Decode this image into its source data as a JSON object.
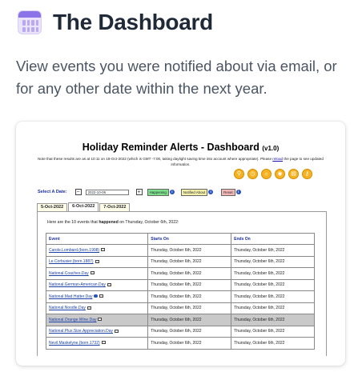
{
  "hero": {
    "icon": "calendar-icon",
    "title": "The Dashboard",
    "description": "View events you were notified about via email, or for any other date within the next year."
  },
  "app": {
    "title": "Holiday Reminder Alerts - Dashboard",
    "version": "(v1.0)",
    "note_before_link": "Note that these results are as at 10:11 on 18-Oct-2022 (which is GMT -7:00, taking daylight saving time into account where appropriate). Please",
    "note_link": "reload",
    "note_after_link": "the page to see updated information.",
    "toolbar_icons": [
      "search-icon",
      "clock-icon",
      "bulb-icon",
      "chat-icon",
      "document-icon",
      "key-icon"
    ],
    "accent_color": "#f6b220"
  },
  "date_selector": {
    "label": "Select A Date:",
    "decrement": "−",
    "value": "2022-10-06",
    "increment": "+",
    "happening_label": "Happening",
    "notified_label": "Notified About",
    "reset_label": "Reset",
    "info_glyph": "i"
  },
  "tabs": [
    "5-Oct-2022",
    "6-Oct-2022",
    "7-Oct-2022"
  ],
  "active_tab": 1,
  "results": {
    "intro_before": "Here are the 10 events that",
    "intro_bold": "happened",
    "intro_after": "on Thursday, October 6th, 2022:",
    "columns": [
      "Event",
      "Starts On",
      "Ends On"
    ],
    "rows": [
      {
        "event": "Carole.Lombard.(born.1908)",
        "starts": "Thursday, October 6th, 2022",
        "ends": "Thursday, October 6th, 2022"
      },
      {
        "event": "Le.Corbusier.(born.1887)",
        "starts": "Thursday, October 6th, 2022",
        "ends": "Thursday, October 6th, 2022"
      },
      {
        "event": "National.Coaches.Day",
        "starts": "Thursday, October 6th, 2022",
        "ends": "Thursday, October 6th, 2022"
      },
      {
        "event": "National.German-American.Day",
        "starts": "Thursday, October 6th, 2022",
        "ends": "Thursday, October 6th, 2022"
      },
      {
        "event": "National.Mad.Hatter.Day",
        "starts": "Thursday, October 6th, 2022",
        "ends": "Thursday, October 6th, 2022"
      },
      {
        "event": "National.Noodle.Day",
        "starts": "Thursday, October 6th, 2022",
        "ends": "Thursday, October 6th, 2022"
      },
      {
        "event": "National.Orange.Wine.Day",
        "starts": "Thursday, October 6th, 2022",
        "ends": "Thursday, October 6th, 2022"
      },
      {
        "event": "National.Plus.Size.Appreciation.Day",
        "starts": "Thursday, October 6th, 2022",
        "ends": "Thursday, October 6th, 2022"
      },
      {
        "event": "Nevil.Maskelyne.(born.1732)",
        "starts": "Thursday, October 6th, 2022",
        "ends": "Thursday, October 6th, 2022"
      }
    ],
    "highlighted_row": 6,
    "info_row": 4
  }
}
